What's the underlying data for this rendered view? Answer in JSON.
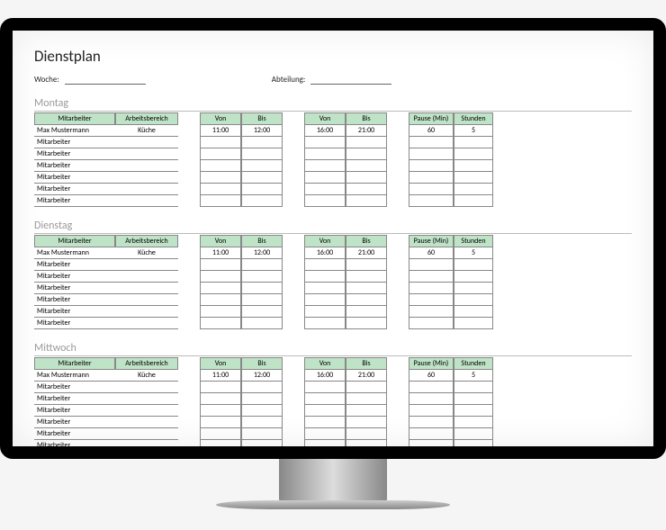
{
  "title": "Dienstplan",
  "meta": {
    "week_label": "Woche:",
    "week_value": "",
    "dept_label": "Abteilung:",
    "dept_value": ""
  },
  "headers": {
    "employee": "Mitarbeiter",
    "area": "Arbeitsbereich",
    "from": "Von",
    "to": "Bis",
    "pause": "Pause (Min)",
    "hours": "Stunden"
  },
  "days": [
    {
      "name": "Montag",
      "rows": [
        {
          "employee": "Max Mustermann",
          "area": "Küche",
          "from1": "11:00",
          "to1": "12:00",
          "from2": "16:00",
          "to2": "21:00",
          "pause": "60",
          "hours": "5"
        },
        {
          "employee": "Mitarbeiter",
          "area": "",
          "from1": "",
          "to1": "",
          "from2": "",
          "to2": "",
          "pause": "",
          "hours": ""
        },
        {
          "employee": "Mitarbeiter",
          "area": "",
          "from1": "",
          "to1": "",
          "from2": "",
          "to2": "",
          "pause": "",
          "hours": ""
        },
        {
          "employee": "Mitarbeiter",
          "area": "",
          "from1": "",
          "to1": "",
          "from2": "",
          "to2": "",
          "pause": "",
          "hours": ""
        },
        {
          "employee": "Mitarbeiter",
          "area": "",
          "from1": "",
          "to1": "",
          "from2": "",
          "to2": "",
          "pause": "",
          "hours": ""
        },
        {
          "employee": "Mitarbeiter",
          "area": "",
          "from1": "",
          "to1": "",
          "from2": "",
          "to2": "",
          "pause": "",
          "hours": ""
        },
        {
          "employee": "Mitarbeiter",
          "area": "",
          "from1": "",
          "to1": "",
          "from2": "",
          "to2": "",
          "pause": "",
          "hours": ""
        }
      ]
    },
    {
      "name": "Dienstag",
      "rows": [
        {
          "employee": "Max Mustermann",
          "area": "Küche",
          "from1": "11:00",
          "to1": "12:00",
          "from2": "16:00",
          "to2": "21:00",
          "pause": "60",
          "hours": "5"
        },
        {
          "employee": "Mitarbeiter",
          "area": "",
          "from1": "",
          "to1": "",
          "from2": "",
          "to2": "",
          "pause": "",
          "hours": ""
        },
        {
          "employee": "Mitarbeiter",
          "area": "",
          "from1": "",
          "to1": "",
          "from2": "",
          "to2": "",
          "pause": "",
          "hours": ""
        },
        {
          "employee": "Mitarbeiter",
          "area": "",
          "from1": "",
          "to1": "",
          "from2": "",
          "to2": "",
          "pause": "",
          "hours": ""
        },
        {
          "employee": "Mitarbeiter",
          "area": "",
          "from1": "",
          "to1": "",
          "from2": "",
          "to2": "",
          "pause": "",
          "hours": ""
        },
        {
          "employee": "Mitarbeiter",
          "area": "",
          "from1": "",
          "to1": "",
          "from2": "",
          "to2": "",
          "pause": "",
          "hours": ""
        },
        {
          "employee": "Mitarbeiter",
          "area": "",
          "from1": "",
          "to1": "",
          "from2": "",
          "to2": "",
          "pause": "",
          "hours": ""
        }
      ]
    },
    {
      "name": "Mittwoch",
      "rows": [
        {
          "employee": "Max Mustermann",
          "area": "Küche",
          "from1": "11:00",
          "to1": "12:00",
          "from2": "16:00",
          "to2": "21:00",
          "pause": "60",
          "hours": "5"
        },
        {
          "employee": "Mitarbeiter",
          "area": "",
          "from1": "",
          "to1": "",
          "from2": "",
          "to2": "",
          "pause": "",
          "hours": ""
        },
        {
          "employee": "Mitarbeiter",
          "area": "",
          "from1": "",
          "to1": "",
          "from2": "",
          "to2": "",
          "pause": "",
          "hours": ""
        },
        {
          "employee": "Mitarbeiter",
          "area": "",
          "from1": "",
          "to1": "",
          "from2": "",
          "to2": "",
          "pause": "",
          "hours": ""
        },
        {
          "employee": "Mitarbeiter",
          "area": "",
          "from1": "",
          "to1": "",
          "from2": "",
          "to2": "",
          "pause": "",
          "hours": ""
        },
        {
          "employee": "Mitarbeiter",
          "area": "",
          "from1": "",
          "to1": "",
          "from2": "",
          "to2": "",
          "pause": "",
          "hours": ""
        },
        {
          "employee": "Mitarbeiter",
          "area": "",
          "from1": "",
          "to1": "",
          "from2": "",
          "to2": "",
          "pause": "",
          "hours": ""
        }
      ]
    }
  ]
}
